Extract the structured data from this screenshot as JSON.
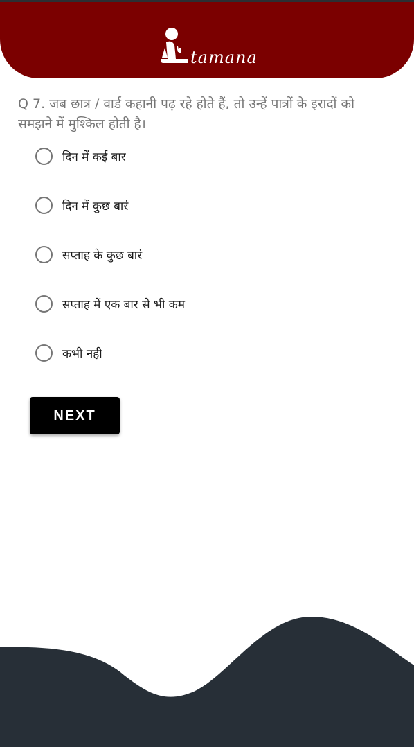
{
  "header": {
    "logo_text": "tamana",
    "background_color": "#7b0000"
  },
  "question": {
    "text": "Q 7. जब छात्र / वार्ड कहानी पढ़ रहे होते हैं, तो उन्हें पात्रों के इरादों को समझने में मुश्किल होती है।"
  },
  "options": [
    {
      "label": "दिन में कई बार"
    },
    {
      "label": "दिन में कुछ बारं"
    },
    {
      "label": "सप्ताह के कुछ बारं"
    },
    {
      "label": "सप्ताह में एक बार से भी कम"
    },
    {
      "label": "कभी नही"
    }
  ],
  "actions": {
    "next_label": "NEXT"
  },
  "footer": {
    "wave_color": "#272f37"
  }
}
